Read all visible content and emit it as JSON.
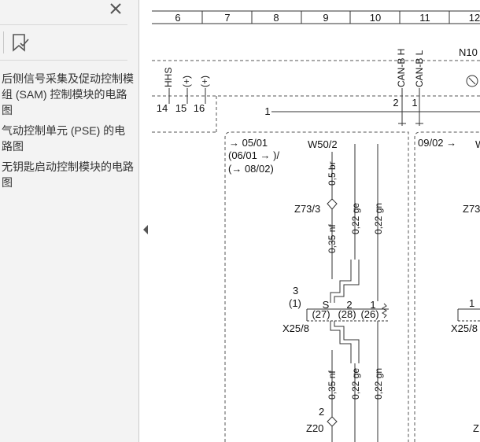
{
  "sidebar": {
    "close_icon": "close-icon",
    "bookmark_icon": "bookmark-icon",
    "items": [
      {
        "label": "后侧信号采集及促动控制模组 (SAM) 控制模块的电路图"
      },
      {
        "label": "气动控制单元 (PSE) 的电路图"
      },
      {
        "label": "无钥匙启动控制模块的电路图"
      }
    ],
    "collapse_icon": "collapse-left-icon"
  },
  "diagram": {
    "columns": [
      "6",
      "7",
      "8",
      "9",
      "10",
      "11",
      "12"
    ],
    "module_label": "N10",
    "upper_pins": [
      {
        "signal": "HHS",
        "pin": "14"
      },
      {
        "signal": "(+)",
        "pin": "15"
      },
      {
        "signal": "(+)",
        "pin": "16"
      }
    ],
    "can_pins": [
      {
        "signal": "CAN-B H",
        "pin": "2"
      },
      {
        "signal": "CAN-B L",
        "pin": "1"
      }
    ],
    "bus_pin": "1",
    "left_box": {
      "ref_line1": "05/01",
      "ref_line2": "(06/01",
      "ref_line2_tail": ")/",
      "ref_line3": "08/02)",
      "wire_group": "W50/2",
      "wires_upper": [
        "0,5 br",
        "0,35 nf",
        "0,22 ge",
        "0,22 gn"
      ],
      "splice": "Z73/3",
      "connector": "X25/8",
      "connector_top_pin": "3",
      "connector_top_pin_alt": "(1)",
      "connector_pins": [
        {
          "top": "S",
          "bottom": "(27)"
        },
        {
          "top": "2",
          "bottom": "(28)"
        },
        {
          "top": "1",
          "bottom": "(26)"
        }
      ],
      "wires_lower": [
        "0,35 nf",
        "0,22 ge",
        "0,22 gn"
      ],
      "ground_pin": "2",
      "ground_splice": "Z20"
    },
    "right_box": {
      "ref": "09/02",
      "wire_group_partial": "W",
      "splice_partial": "Z73",
      "connector_pin": "1",
      "connector": "X25/8",
      "bottom_partial": "Z"
    }
  }
}
